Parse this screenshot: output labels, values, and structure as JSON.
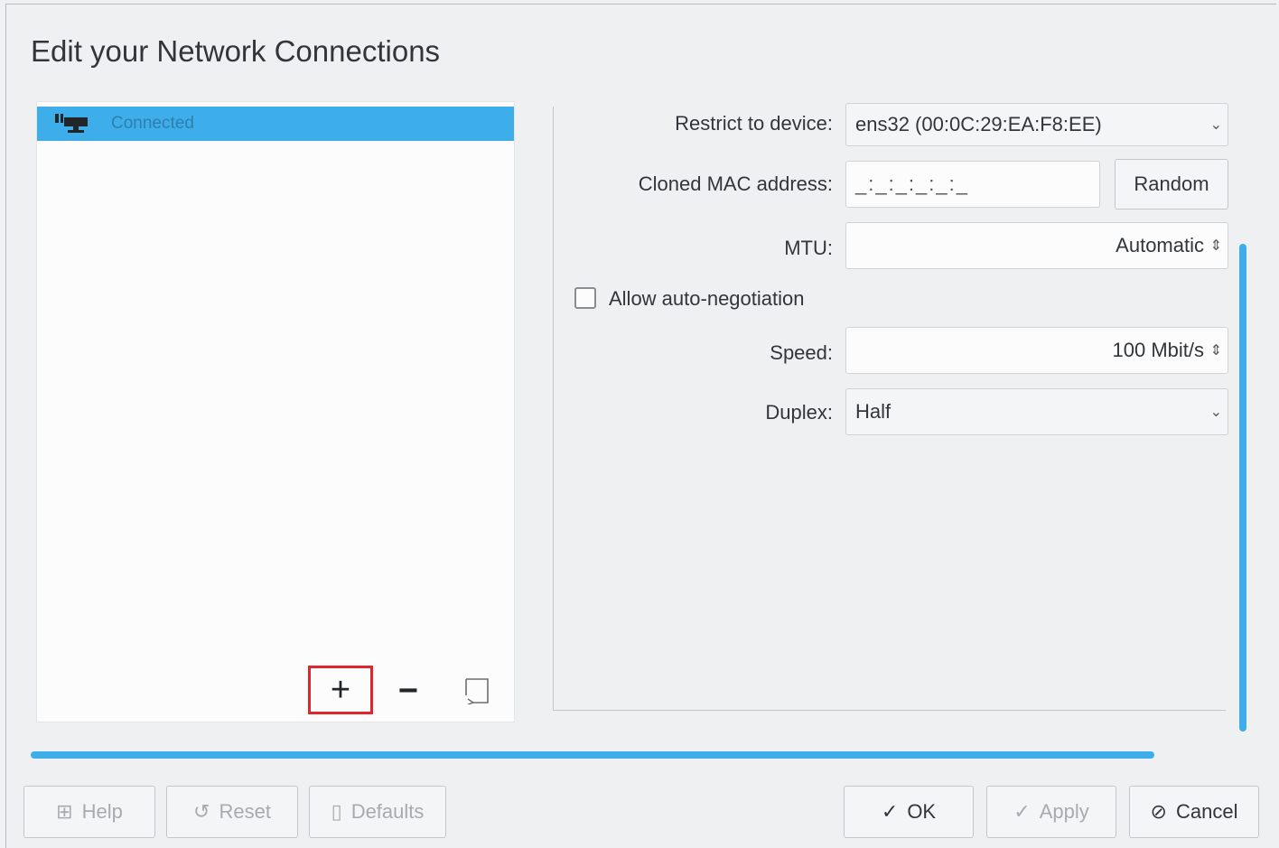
{
  "window": {
    "title": "Edit your Network Connections"
  },
  "connections": {
    "items": [
      {
        "status": "Connected"
      }
    ],
    "add_symbol": "+",
    "remove_symbol": "−"
  },
  "settings": {
    "restrict_device": {
      "label": "Restrict to device:",
      "value": "ens32 (00:0C:29:EA:F8:EE)"
    },
    "cloned_mac": {
      "label": "Cloned MAC address:",
      "value": "_:_:_:_:_:_",
      "random_label": "Random"
    },
    "mtu": {
      "label": "MTU:",
      "value": "Automatic"
    },
    "auto_negotiation": {
      "label": "Allow auto-negotiation",
      "checked": false
    },
    "speed": {
      "label": "Speed:",
      "value": "100 Mbit/s"
    },
    "duplex": {
      "label": "Duplex:",
      "value": "Half"
    }
  },
  "footer": {
    "help_label": "Help",
    "reset_label": "Reset",
    "defaults_label": "Defaults",
    "ok_label": "OK",
    "apply_label": "Apply",
    "cancel_label": "Cancel"
  },
  "colors": {
    "selection": "#3daee9",
    "highlight_box": "#e0262c"
  }
}
